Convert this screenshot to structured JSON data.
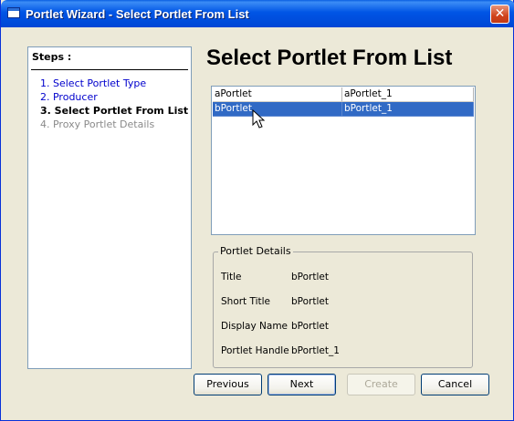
{
  "window": {
    "title": "Portlet Wizard - Select Portlet From List",
    "close_glyph": "✕"
  },
  "steps": {
    "header": "Steps :",
    "items": [
      {
        "label": "1. Select Portlet Type",
        "state": "done"
      },
      {
        "label": "2. Producer",
        "state": "done"
      },
      {
        "label": "3. Select Portlet From List",
        "state": "current"
      },
      {
        "label": "4. Proxy Portlet Details",
        "state": "future"
      }
    ]
  },
  "main": {
    "title": "Select Portlet From List",
    "portlets": [
      {
        "name": "aPortlet",
        "handle": "aPortlet_1",
        "selected": false
      },
      {
        "name": "bPortlet",
        "handle": "bPortlet_1",
        "selected": true
      }
    ]
  },
  "details": {
    "legend": "Portlet Details",
    "fields": [
      {
        "label": "Title",
        "value": "bPortlet"
      },
      {
        "label": "Short Title",
        "value": "bPortlet"
      },
      {
        "label": "Display Name",
        "value": "bPortlet"
      },
      {
        "label": "Portlet Handle",
        "value": "bPortlet_1"
      }
    ]
  },
  "buttons": {
    "previous": "Previous",
    "next": "Next",
    "create": "Create",
    "cancel": "Cancel"
  },
  "colors": {
    "selection": "#316AC5",
    "link": "#0000CC",
    "titlebar": "#0055E5"
  }
}
